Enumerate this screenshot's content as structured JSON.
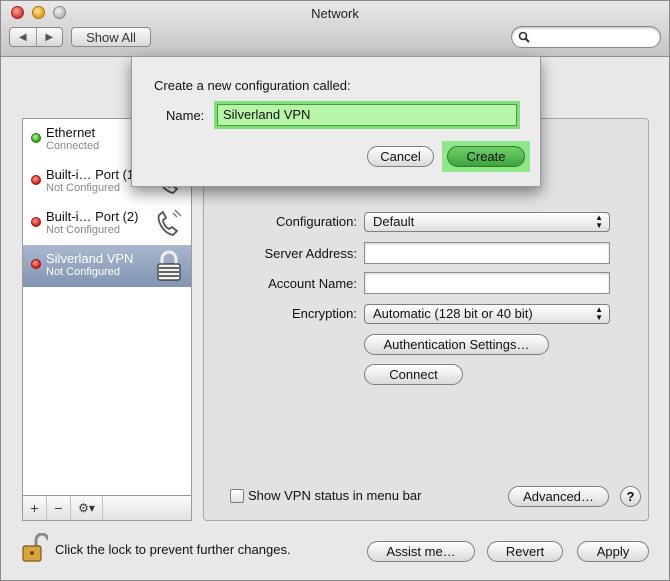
{
  "window": {
    "title": "Network"
  },
  "toolbar": {
    "back": "◀",
    "forward": "▶",
    "show_all": "Show All",
    "search_placeholder": ""
  },
  "services": [
    {
      "name": "Ethernet",
      "status": "Connected",
      "state": "green"
    },
    {
      "name": "Built-i… Port (1)",
      "status": "Not Configured",
      "state": "red"
    },
    {
      "name": "Built-i… Port (2)",
      "status": "Not Configured",
      "state": "red"
    },
    {
      "name": "Silverland VPN",
      "status": "Not Configured",
      "state": "red"
    }
  ],
  "listbar": {
    "add": "+",
    "remove": "−",
    "gear": "⚙▾"
  },
  "panel": {
    "configuration_label": "Configuration:",
    "configuration_value": "Default",
    "server_label": "Server Address:",
    "server_value": "",
    "account_label": "Account Name:",
    "account_value": "",
    "encryption_label": "Encryption:",
    "encryption_value": "Automatic (128 bit or 40 bit)",
    "auth_button": "Authentication Settings…",
    "connect_button": "Connect",
    "show_status_label": "Show VPN status in menu bar",
    "advanced_button": "Advanced…",
    "help": "?"
  },
  "footer": {
    "lock_text": "Click the lock to prevent further changes.",
    "assist_button": "Assist me…",
    "revert_button": "Revert",
    "apply_button": "Apply"
  },
  "sheet": {
    "prompt": "Create a new configuration called:",
    "name_label": "Name:",
    "name_value": "Silverland VPN",
    "cancel_button": "Cancel",
    "create_button": "Create"
  },
  "colors": {
    "selection": "#8294b3",
    "highlight_green": "#8ee788"
  }
}
